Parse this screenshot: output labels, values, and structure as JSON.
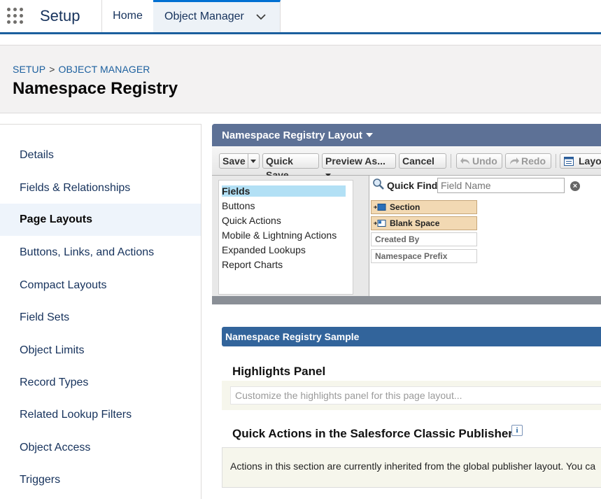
{
  "topnav": {
    "app_name": "Setup",
    "tabs": [
      {
        "label": "Home"
      },
      {
        "label": "Object Manager"
      }
    ]
  },
  "header": {
    "breadcrumb": [
      "SETUP",
      "OBJECT MANAGER"
    ],
    "breadcrumb_separator": ">",
    "title": "Namespace Registry"
  },
  "sidebar": {
    "items": [
      {
        "label": "Details"
      },
      {
        "label": "Fields & Relationships"
      },
      {
        "label": "Page Layouts",
        "active": true
      },
      {
        "label": "Buttons, Links, and Actions"
      },
      {
        "label": "Compact Layouts"
      },
      {
        "label": "Field Sets"
      },
      {
        "label": "Object Limits"
      },
      {
        "label": "Record Types"
      },
      {
        "label": "Related Lookup Filters"
      },
      {
        "label": "Object Access"
      },
      {
        "label": "Triggers"
      }
    ]
  },
  "layout_editor": {
    "title": "Namespace Registry Layout",
    "toolbar": {
      "save": "Save",
      "quick_save": "Quick Save",
      "preview_as": "Preview As...",
      "cancel": "Cancel",
      "undo": "Undo",
      "redo": "Redo",
      "layout": "Layout"
    },
    "palette_categories": [
      {
        "label": "Fields",
        "selected": true
      },
      {
        "label": "Buttons"
      },
      {
        "label": "Quick Actions"
      },
      {
        "label": "Mobile & Lightning Actions"
      },
      {
        "label": "Expanded Lookups"
      },
      {
        "label": "Report Charts"
      }
    ],
    "quick_find": {
      "label": "Quick Find",
      "placeholder": "Field Name"
    },
    "palette_items": [
      {
        "label": "Section",
        "style": "orange"
      },
      {
        "label": "Blank Space",
        "style": "orange"
      },
      {
        "label": "Created By",
        "style": "plain"
      },
      {
        "label": "Namespace Prefix",
        "style": "plain"
      }
    ]
  },
  "sample": {
    "title": "Namespace Registry Sample",
    "highlights_title": "Highlights Panel",
    "highlights_placeholder": "Customize the highlights panel for this page layout...",
    "quick_actions_title": "Quick Actions in the Salesforce Classic Publisher",
    "quick_actions_text": "Actions in this section are currently inherited from the global publisher layout. You ca"
  },
  "colors": {
    "nav_accent": "#1b5f9e",
    "panel_header": "#5d7196",
    "sample_bar": "#32649b",
    "active_sidebar": "#eef4fb",
    "palette_selected": "#b2e0f5"
  }
}
